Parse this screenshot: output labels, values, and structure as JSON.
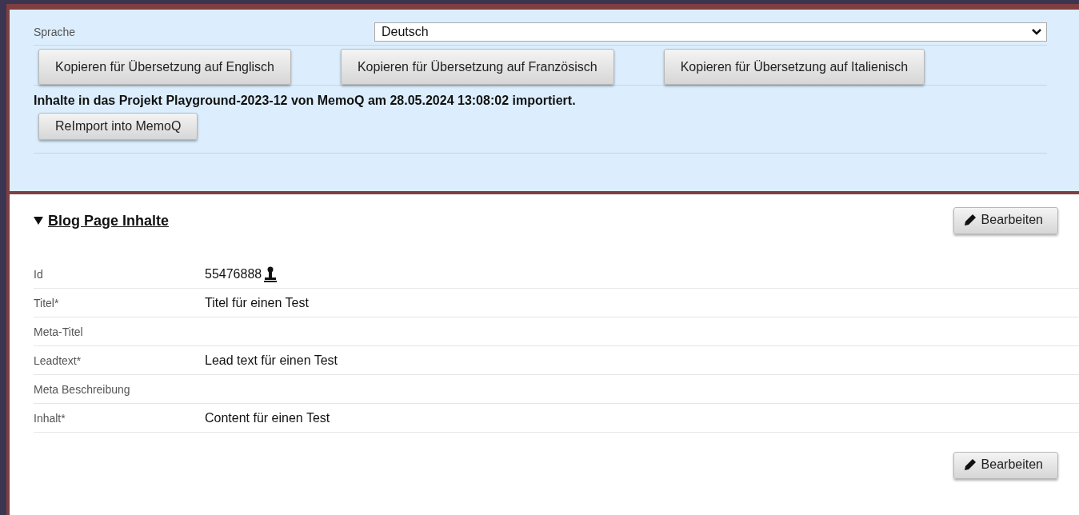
{
  "language_bar": {
    "label": "Sprache",
    "select": {
      "value": "Deutsch"
    }
  },
  "copy_buttons": [
    "Kopieren für Übersetzung auf Englisch",
    "Kopieren für Übersetzung auf Französisch",
    "Kopieren für Übersetzung auf Italienisch"
  ],
  "import_message": "Inhalte in das Projekt Playground-2023-12 von MemoQ am 28.05.2024 13:08:02 importiert.",
  "reimport_button": "ReImport into MemoQ",
  "section": {
    "title": "Blog Page Inhalte",
    "expanded": true,
    "edit_button": "Bearbeiten",
    "fields": [
      {
        "kind": "id",
        "label": "Id",
        "value": "55476888"
      },
      {
        "kind": "text",
        "label": "Titel*",
        "value": "Titel für einen Test"
      },
      {
        "kind": "text",
        "label": "Meta-Titel"
      },
      {
        "kind": "text",
        "label": "Leadtext*",
        "value": "Lead text für einen Test"
      },
      {
        "kind": "text",
        "label": "Meta Beschreibung"
      },
      {
        "kind": "text",
        "label": "Inhalt*",
        "value": "Content für einen Test"
      }
    ],
    "bottom_edit_button": "Bearbeiten"
  }
}
